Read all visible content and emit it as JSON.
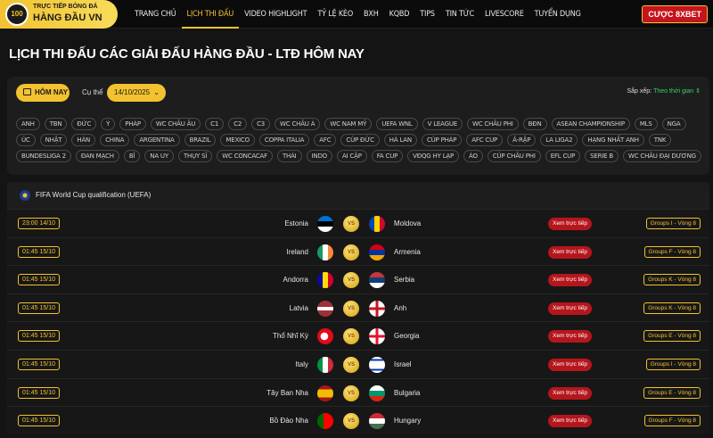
{
  "header": {
    "logo_line1": "TRỰC TIẾP BÓNG ĐÁ",
    "logo_line2": "HÀNG ĐẦU VN",
    "logo_mark": "100",
    "menu": [
      "TRANG CHỦ",
      "LỊCH THI ĐẤU",
      "VIDEO HIGHLIGHT",
      "TỶ LỆ KÈO",
      "BXH",
      "KQBD",
      "TIPS",
      "TIN TỨC",
      "LIVESCORE",
      "TUYỂN DỤNG"
    ],
    "active_menu": "LỊCH THI ĐẤU",
    "cta": "CƯỢC 8XBET"
  },
  "page_title": "LỊCH THI ĐẤU CÁC GIẢI ĐẤU HÀNG ĐẦU - LTĐ HÔM NAY",
  "filters": {
    "today_label": "HÔM NAY",
    "date_label": "Cụ thể",
    "date_value": "14/10/2025",
    "sort_label": "Sắp xếp:",
    "sort_value": "Theo thời gian",
    "leagues": [
      "ANH",
      "TBN",
      "ĐỨC",
      "Ý",
      "PHÁP",
      "WC CHÂU ÂU",
      "C1",
      "C2",
      "C3",
      "WC CHÂU Á",
      "WC NAM MỸ",
      "UEFA WNL",
      "V LEAGUE",
      "WC CHÂU PHI",
      "BĐN",
      "ASEAN CHAMPIONSHIP",
      "MLS",
      "NGA",
      "ÚC",
      "NHẬT",
      "HÀN",
      "CHINA",
      "ARGENTINA",
      "BRAZIL",
      "MEXICO",
      "COPPA ITALIA",
      "AFC",
      "CÚP ĐỨC",
      "HÀ LAN",
      "CÚP PHÁP",
      "AFC CUP",
      "Ả-RẬP",
      "LA LIGA2",
      "HẠNG NHẤT ANH",
      "TNK",
      "BUNDESLIGA 2",
      "ĐAN MẠCH",
      "BỈ",
      "NA UY",
      "THỤY SĨ",
      "WC CONCACAF",
      "THÁI",
      "INDO",
      "AI CẬP",
      "FA CUP",
      "VĐQG HY LẠP",
      "ÁO",
      "CÚP CHÂU PHI",
      "EFL CUP",
      "SERIE B",
      "WC CHÂU ĐẠI DƯƠNG"
    ]
  },
  "league": {
    "name": "FIFA World Cup qualification (UEFA)",
    "icon": "league-globe-icon"
  },
  "matches": [
    {
      "time": "23:00 14/10",
      "home": "Estonia",
      "away": "Moldova",
      "watch": "Xem trực tiếp",
      "group": "Groups I - Vòng 8",
      "home_flag": "estonia",
      "away_flag": "moldova"
    },
    {
      "time": "01:45 15/10",
      "home": "Ireland",
      "away": "Armenia",
      "watch": "Xem trực tiếp",
      "group": "Groups F - Vòng 8",
      "home_flag": "ireland",
      "away_flag": "armenia"
    },
    {
      "time": "01:45 15/10",
      "home": "Andorra",
      "away": "Serbia",
      "watch": "Xem trực tiếp",
      "group": "Groups K - Vòng 8",
      "home_flag": "andorra",
      "away_flag": "serbia"
    },
    {
      "time": "01:45 15/10",
      "home": "Latvia",
      "away": "Anh",
      "watch": "Xem trực tiếp",
      "group": "Groups K - Vòng 8",
      "home_flag": "latvia",
      "away_flag": "england"
    },
    {
      "time": "01:45 15/10",
      "home": "Thổ Nhĩ Kỳ",
      "away": "Georgia",
      "watch": "Xem trực tiếp",
      "group": "Groups E - Vòng 8",
      "home_flag": "turkey",
      "away_flag": "georgia"
    },
    {
      "time": "01:45 15/10",
      "home": "Italy",
      "away": "Israel",
      "watch": "Xem trực tiếp",
      "group": "Groups I - Vòng 8",
      "home_flag": "italy",
      "away_flag": "israel"
    },
    {
      "time": "01:45 15/10",
      "home": "Tây Ban Nha",
      "away": "Bulgaria",
      "watch": "Xem trực tiếp",
      "group": "Groups E - Vòng 8",
      "home_flag": "spain",
      "away_flag": "bulgaria"
    },
    {
      "time": "01:45 15/10",
      "home": "Bồ Đào Nha",
      "away": "Hungary",
      "watch": "Xem trực tiếp",
      "group": "Groups F - Vòng 8",
      "home_flag": "portugal",
      "away_flag": "hungary"
    }
  ],
  "vs_label": "VS",
  "colors": {
    "accent": "#f2c230",
    "live": "#b5161c",
    "sort": "#37d06b",
    "bg": "#141414"
  }
}
